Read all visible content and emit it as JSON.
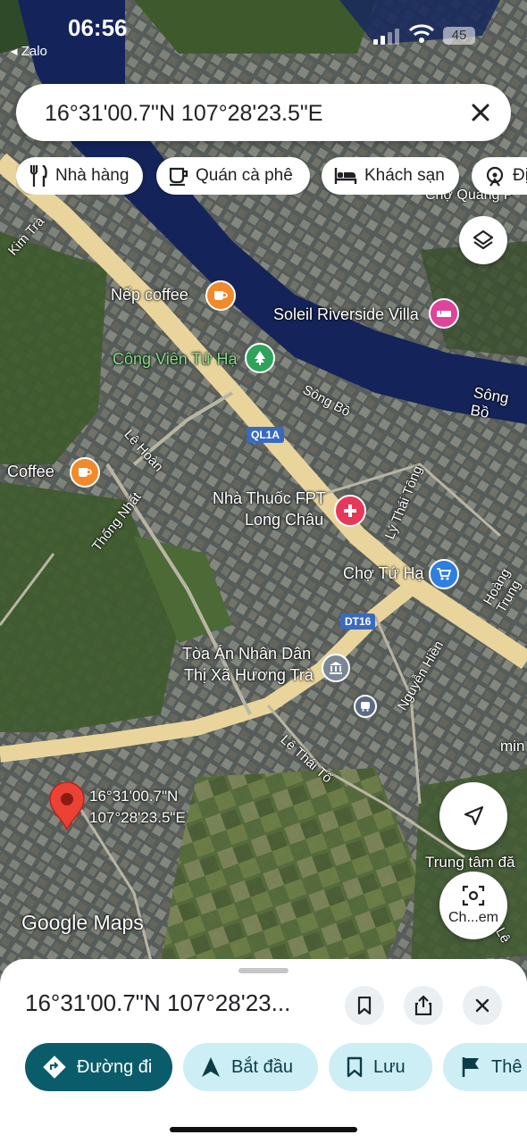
{
  "status_bar": {
    "time": "06:56",
    "back_label": "◂ Zalo",
    "battery": "45"
  },
  "search": {
    "query": "16°31'00.7\"N 107°28'23.5\"E"
  },
  "chips": [
    {
      "label": "Nhà hàng",
      "icon": "fork-knife-icon"
    },
    {
      "label": "Quán cà phê",
      "icon": "coffee-cup-icon"
    },
    {
      "label": "Khách sạn",
      "icon": "bed-icon"
    },
    {
      "label": "Địa",
      "icon": "attraction-icon"
    }
  ],
  "map": {
    "pois": [
      {
        "label": "Nếp coffee",
        "kind": "cafe"
      },
      {
        "label": "Soleil Riverside Villa",
        "kind": "hotel"
      },
      {
        "label": "Công Viên Tứ Hạ",
        "kind": "park"
      },
      {
        "label": "Coffee",
        "kind": "cafe"
      },
      {
        "label": "Nhà Thuốc FPT",
        "label2": "Long Châu",
        "kind": "pharmacy"
      },
      {
        "label": "Chợ Tứ Hạ",
        "kind": "shopping"
      },
      {
        "label": "Tòa Án Nhân Dân",
        "label2": "Thị Xã Hương Trà",
        "kind": "government"
      }
    ],
    "streets": [
      "Kim Trà",
      "Sông Bồ",
      "Sông Bồ",
      "Lê Hoàn",
      "Thống Nhất",
      "Lý Thái Tông",
      "Hoàng Trung",
      "Nguyễn Hiền",
      "Lê Thái Tổ",
      "Chợ Quảng P"
    ],
    "shields": [
      "QL1A",
      "DT16"
    ],
    "pin_label_line1": "16°31'00.7\"N",
    "pin_label_line2": "107°28'23.5\"E",
    "extra_labels": [
      "min",
      "Trung tâm đă",
      "Lê"
    ],
    "branding": "Google Maps",
    "street_view_label": "Ch...em"
  },
  "sheet": {
    "title": "16°31'00.7\"N 107°28'23...",
    "actions": [
      {
        "label": "Đường đi",
        "icon": "directions-icon"
      },
      {
        "label": "Bắt đầu",
        "icon": "navigation-arrow-icon"
      },
      {
        "label": "Lưu",
        "icon": "bookmark-icon"
      },
      {
        "label": "Thê",
        "icon": "flag-icon"
      }
    ]
  },
  "colors": {
    "river": "#14245a",
    "main_road": "#e9d59c",
    "action_primary": "#0b5c6b",
    "action_secondary": "#cdeef5",
    "pin": "#ea4335"
  }
}
